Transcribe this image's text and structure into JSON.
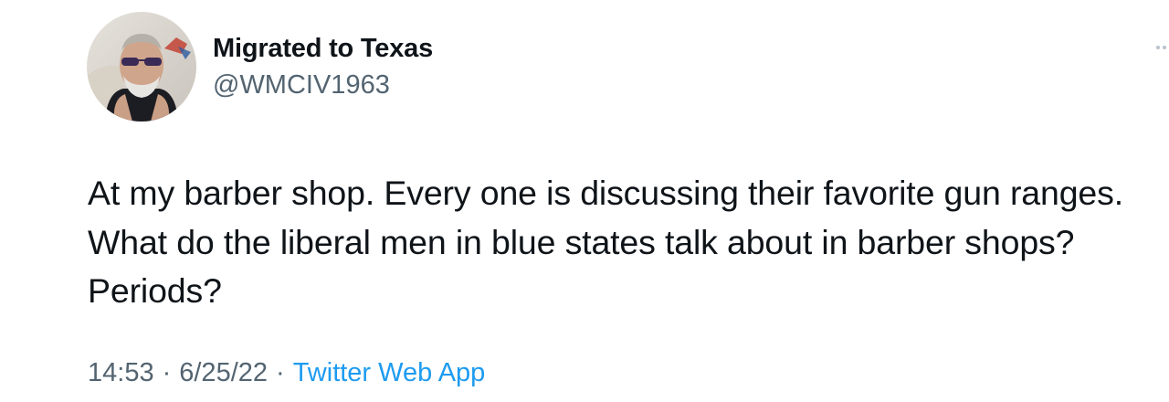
{
  "author": {
    "display_name": "Migrated to Texas",
    "handle": "@WMCIV1963"
  },
  "tweet": {
    "text": "At my barber shop.  Every one is discussing their favorite gun ranges.  What do the liberal men in blue states talk about in barber shops?  Periods?"
  },
  "meta": {
    "time": "14:53",
    "separator": "·",
    "date": "6/25/22",
    "source": "Twitter Web App"
  },
  "icons": {
    "more": "more-horizontal-icon",
    "avatar": "avatar"
  },
  "colors": {
    "primary_text": "#0f1419",
    "secondary_text": "#536471",
    "link": "#1d9bf0"
  }
}
